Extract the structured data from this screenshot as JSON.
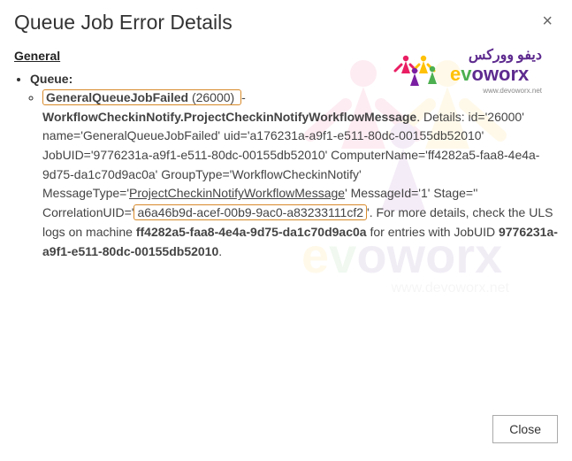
{
  "header": {
    "title": "Queue Job Error Details",
    "close_x": "×"
  },
  "section": {
    "general_label": "General"
  },
  "queue": {
    "label": "Queue:",
    "error_name_bold": "GeneralQueueJobFailed",
    "error_code": " (26000) ",
    "dash": "- ",
    "message_type_bold": "WorkflowCheckinNotify.ProjectCheckinNotifyWorkflowMessage",
    "details_prefix": ". Details: id='26000' name='GeneralQueueJobFailed' uid='a176231a-a9f1-e511-80dc-00155db52010' JobUID='9776231a-a9f1-e511-80dc-00155db52010' ComputerName='ff4282a5-faa8-4e4a-9d75-da1c70d9ac0a' GroupType='WorkflowCheckinNotify' MessageType='",
    "msg_type_underlined": "ProjectCheckinNotifyWorkflowMessage",
    "details_mid": "' MessageId='1' Stage='' CorrelationUID='",
    "correlation_uid": "a6a46b9d-acef-00b9-9ac0-a83233111cf2",
    "details_after_corr": "'. For more details, check the ULS logs on machine ",
    "computer_bold": "ff4282a5-faa8-4e4a-9d75-da1c70d9ac0a",
    "details_job_prefix": " for entries with JobUID ",
    "jobuid_bold": "9776231a-a9f1-e511-80dc-00155db52010",
    "period": "."
  },
  "footer": {
    "close_label": "Close"
  },
  "logo": {
    "brand_arabic": "ديفو ووركس",
    "brand_latin": "evoworx",
    "brand_sub": "www.devoworx.net"
  }
}
